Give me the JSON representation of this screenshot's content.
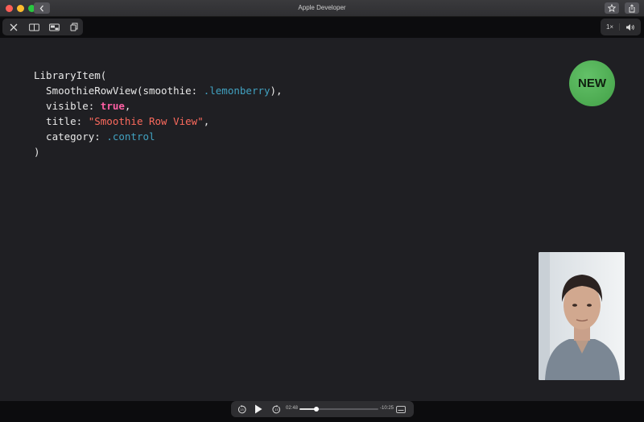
{
  "window": {
    "title": "Apple Developer"
  },
  "player": {
    "speed_label": "1×",
    "elapsed": "02:48",
    "remaining": "-10:25",
    "progress": 0.21
  },
  "slide": {
    "badge": "NEW",
    "code_lines": [
      [
        {
          "t": "LibraryItem(",
          "c": "plain"
        }
      ],
      [
        {
          "t": "  SmoothieRowView",
          "c": "plain"
        },
        {
          "t": "(smoothie: ",
          "c": "plain"
        },
        {
          "t": ".lemonberry",
          "c": "mem"
        },
        {
          "t": "),",
          "c": "plain"
        }
      ],
      [
        {
          "t": "  visible: ",
          "c": "plain"
        },
        {
          "t": "true",
          "c": "kw"
        },
        {
          "t": ",",
          "c": "plain"
        }
      ],
      [
        {
          "t": "  title: ",
          "c": "plain"
        },
        {
          "t": "\"Smoothie Row View\"",
          "c": "str"
        },
        {
          "t": ",",
          "c": "plain"
        }
      ],
      [
        {
          "t": "  category: ",
          "c": "plain"
        },
        {
          "t": ".control",
          "c": "mem"
        }
      ],
      [
        {
          "t": ")",
          "c": "plain"
        }
      ]
    ]
  },
  "colors": {
    "badge_green": "#4caf50",
    "keyword_pink": "#fc5fa3",
    "string_red": "#fc6a5d",
    "member_blue": "#41a1c0"
  },
  "icons": {
    "close": "close-icon",
    "layout_split": "split-view-icon",
    "picture_in_picture": "picture-in-picture-icon",
    "copy": "copy-code-icon",
    "volume": "volume-icon",
    "skip_back": "skip-back-15-icon",
    "play": "play-icon",
    "skip_forward": "skip-forward-15-icon",
    "captions": "captions-icon"
  }
}
